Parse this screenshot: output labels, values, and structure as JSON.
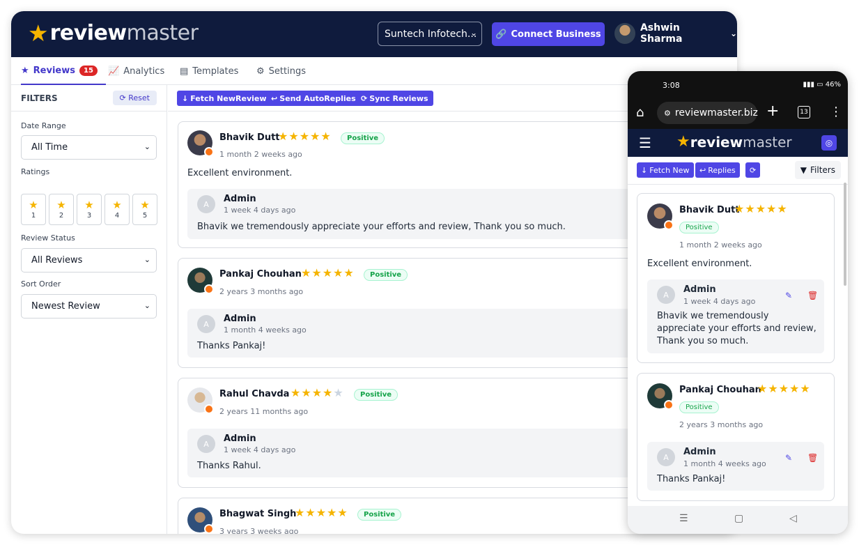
{
  "brand": {
    "word_bold": "review",
    "word_light": "master"
  },
  "header": {
    "business": "Suntech Infotech...",
    "connect_label": "Connect Business",
    "user_name": "Ashwin Sharma"
  },
  "tabs": [
    {
      "label": "Reviews",
      "badge": "15"
    },
    {
      "label": "Analytics"
    },
    {
      "label": "Templates"
    },
    {
      "label": "Settings"
    }
  ],
  "filters": {
    "title": "FILTERS",
    "reset_label": "Reset",
    "date_range_label": "Date Range",
    "date_range_value": "All Time",
    "ratings_label": "Ratings",
    "ratings": [
      "1",
      "2",
      "3",
      "4",
      "5"
    ],
    "status_label": "Review Status",
    "status_value": "All Reviews",
    "sort_label": "Sort Order",
    "sort_value": "Newest Review"
  },
  "actions": {
    "fetch": "Fetch NewReviews",
    "send": "Send AutoReplies",
    "sync": "Sync Reviews"
  },
  "reviews": [
    {
      "name": "Bhavik Dutt",
      "rating": 5,
      "sentiment": "Positive",
      "time": "1 month 2 weeks ago",
      "text": "Excellent environment.",
      "reply_author": "Admin",
      "reply_time": "1 week 4 days ago",
      "reply_text": "Bhavik we tremendously appreciate your efforts and review, Thank you so much."
    },
    {
      "name": "Pankaj Chouhan",
      "rating": 5,
      "sentiment": "Positive",
      "time": "2 years 3 months ago",
      "text": "",
      "reply_author": "Admin",
      "reply_time": "1 month 4 weeks ago",
      "reply_text": "Thanks Pankaj!"
    },
    {
      "name": "Rahul Chavda",
      "rating": 4,
      "sentiment": "Positive",
      "time": "2 years 11 months ago",
      "text": "",
      "reply_author": "Admin",
      "reply_time": "1 week 4 days ago",
      "reply_text": "Thanks Rahul."
    },
    {
      "name": "Bhagwat Singh",
      "rating": 5,
      "sentiment": "Positive",
      "time": "3 years 3 weeks ago"
    }
  ],
  "mobile": {
    "time": "3:08",
    "battery": "46%",
    "url": "reviewmaster.biz",
    "tab_count": "13",
    "fetch": "Fetch New",
    "replies": "Replies",
    "filters": "Filters",
    "reply_text_1": "Bhavik we tremendously appreciate your efforts and review, Thank you so much."
  },
  "colors": {
    "navy": "#0f1b3d",
    "accent": "#4f46e5",
    "star": "#f5b400",
    "positive": "#16a34a",
    "danger": "#dc2626"
  }
}
